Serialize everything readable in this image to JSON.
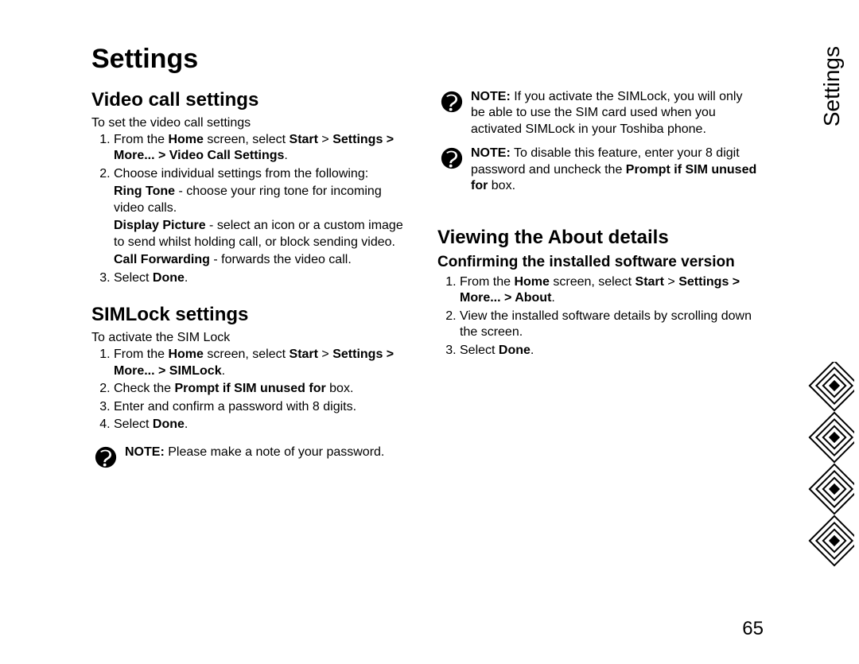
{
  "title": "Settings",
  "side_label": "Settings",
  "page_number": "65",
  "left": {
    "video": {
      "heading": "Video call settings",
      "lead": "To set the video call settings",
      "step1_a": "From the ",
      "step1_b": "Home",
      "step1_c": " screen, select ",
      "step1_d": "Start",
      "step1_e": " > ",
      "step1_f": "Settings",
      "step1_g": " > ",
      "step1_h": "More...",
      "step1_i": " > ",
      "step1_j": "Video Call Settings",
      "step1_k": ".",
      "step2_intro": "Choose individual settings from the following:",
      "step2_rt_b": "Ring Tone",
      "step2_rt_t": " - choose your ring tone for incoming video calls.",
      "step2_dp_b": "Display Picture",
      "step2_dp_t": " - select an icon or a custom image to send whilst holding call, or block sending video.",
      "step2_cf_b": "Call Forwarding",
      "step2_cf_t": " - forwards the video call.",
      "step3_a": "Select ",
      "step3_b": "Done",
      "step3_c": "."
    },
    "simlock": {
      "heading": "SIMLock settings",
      "lead": "To activate the SIM Lock",
      "step1_a": "From the ",
      "step1_b": "Home",
      "step1_c": " screen, select ",
      "step1_d": "Start",
      "step1_e": " > ",
      "step1_f": "Settings",
      "step1_g": " > ",
      "step1_h": "More...",
      "step1_i": " > ",
      "step1_j": "SIMLock",
      "step1_k": ".",
      "step2_a": "Check the ",
      "step2_b": "Prompt if SIM unused for",
      "step2_c": " box.",
      "step3": "Enter and confirm a password with 8 digits.",
      "step4_a": "Select ",
      "step4_b": "Done",
      "step4_c": "."
    },
    "note_pw": {
      "label": "NOTE:",
      "text": " Please make a note of your password."
    }
  },
  "right": {
    "note_activate": {
      "label": "NOTE:",
      "text": " If you activate the SIMLock, you will only be able to use the SIM card used when you activated SIMLock in your Toshiba phone."
    },
    "note_disable": {
      "label": "NOTE:",
      "text_a": " To disable this feature, enter your 8 digit password and uncheck the ",
      "text_b": "Prompt if SIM unused for",
      "text_c": " box."
    },
    "about": {
      "heading": "Viewing the About details",
      "sub": "Confirming the installed software version",
      "step1_a": "From the ",
      "step1_b": "Home",
      "step1_c": " screen, select ",
      "step1_d": "Start",
      "step1_e": " > ",
      "step1_f": "Settings",
      "step1_g": " > ",
      "step1_h": "More...",
      "step1_i": " > ",
      "step1_j": "About",
      "step1_k": ".",
      "step2": "View the installed software details by scrolling down the screen.",
      "step3_a": "Select ",
      "step3_b": "Done",
      "step3_c": "."
    }
  }
}
